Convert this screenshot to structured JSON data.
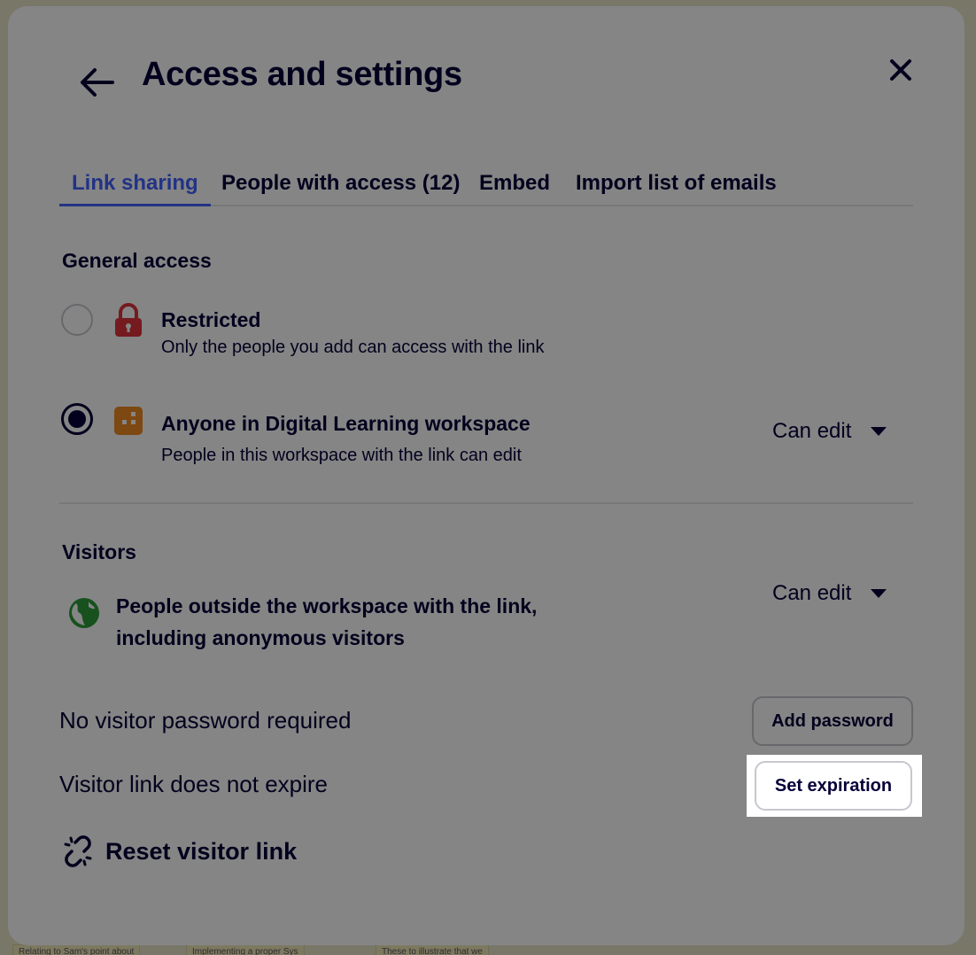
{
  "background_notes": [
    "Relating to Sam's point about",
    "Implementing a proper Sys",
    "These to illustrate that we"
  ],
  "dialog": {
    "title": "Access and settings",
    "back_icon": "arrow-left-icon",
    "close_icon": "close-icon"
  },
  "tabs": [
    {
      "label": "Link sharing",
      "active": true
    },
    {
      "label": "People with access (12)",
      "active": false
    },
    {
      "label": "Embed",
      "active": false
    },
    {
      "label": "Import list of emails",
      "active": false
    }
  ],
  "general_access": {
    "title": "General access",
    "options": [
      {
        "icon": "lock-icon",
        "label": "Restricted",
        "description": "Only the people you add can access with the link",
        "checked": false
      },
      {
        "icon": "workspace-building-icon",
        "label": "Anyone in Digital Learning workspace",
        "description": "People in this workspace with the link can edit",
        "checked": true,
        "permission": "Can edit"
      }
    ]
  },
  "visitors": {
    "title": "Visitors",
    "icon": "globe-icon",
    "description": "People outside the workspace with the link, including anonymous visitors",
    "permission": "Can edit"
  },
  "password": {
    "status": "No visitor password required",
    "button": "Add password"
  },
  "expiration": {
    "status": "Visitor link does not expire",
    "button": "Set expiration"
  },
  "reset": {
    "icon": "broken-link-icon",
    "label": "Reset visitor link"
  },
  "colors": {
    "text": "#050038",
    "accent": "#4262ff",
    "lock": "#e0323c",
    "workspace": "#f08a24",
    "globe": "#2d9b3a"
  }
}
